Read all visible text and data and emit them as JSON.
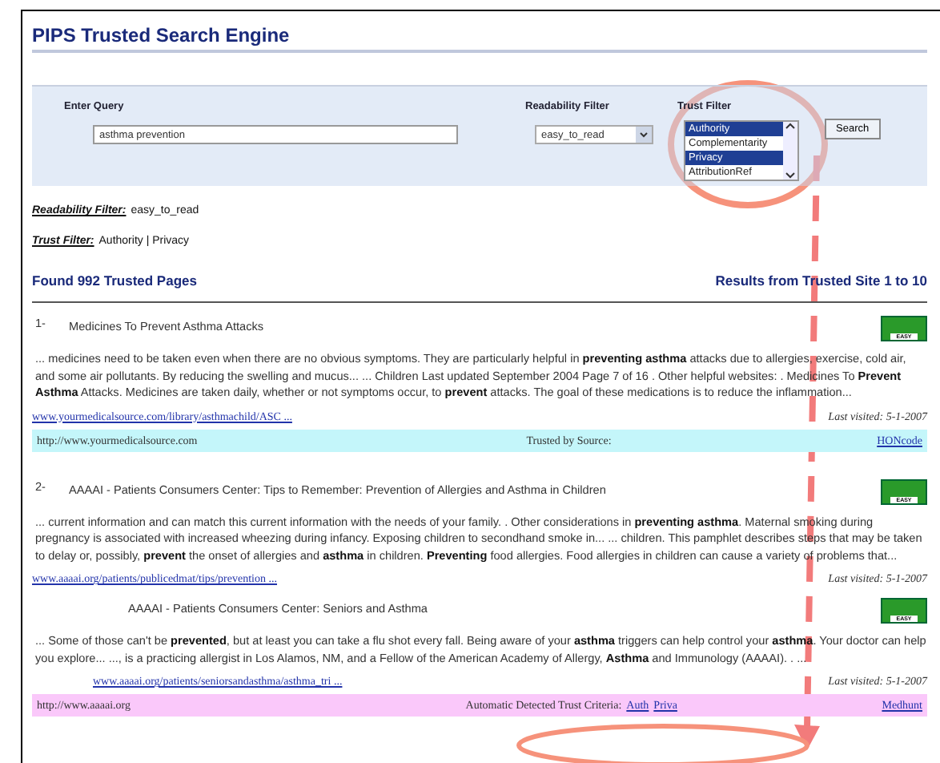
{
  "title": "PIPS Trusted Search Engine",
  "query": {
    "label": "Enter Query",
    "value": "asthma prevention"
  },
  "readability": {
    "label": "Readability Filter",
    "value": "easy_to_read"
  },
  "trust": {
    "label": "Trust Filter",
    "options": [
      {
        "label": "Authority",
        "selected": true
      },
      {
        "label": "Complementarity",
        "selected": false
      },
      {
        "label": "Privacy",
        "selected": true
      },
      {
        "label": "AttributionRef",
        "selected": false
      }
    ]
  },
  "search_button": "Search",
  "applied_filters": [
    {
      "label": "Readability Filter:",
      "value": "easy_to_read"
    },
    {
      "label": "Trust Filter:",
      "value": "Authority | Privacy"
    }
  ],
  "found": "Found 992 Trusted Pages",
  "range": "Results from Trusted Site 1 to 10",
  "groups": [
    {
      "results": [
        {
          "kind": "main",
          "number": "1-",
          "title": "Medicines To Prevent Asthma Attacks",
          "badge": "EASY",
          "snippet": "... medicines need to be taken even when there are no obvious symptoms. They are particularly helpful in **preventing asthma** attacks due to allergies, exercise, cold air, and some air pollutants. By reducing the swelling and mucus... ... Children Last updated September 2004 Page 7 of 16 . Other helpful websites: . Medicines To **Prevent Asthma** Attacks. Medicines are taken daily, whether or not symptoms occur, to **prevent** attacks. The goal of these medications is to reduce the inflammation...",
          "url": "www.yourmedicalsource.com/library/asthmachild/ASC ...",
          "last_visited": "Last visited: 5-1-2007"
        }
      ],
      "bar": {
        "color": "#c4f6fa",
        "site": "http://www.yourmedicalsource.com",
        "label": "Trusted by Source:",
        "source": "HONcode"
      }
    },
    {
      "results": [
        {
          "kind": "main",
          "number": "2-",
          "title": "AAAAI - Patients Consumers Center: Tips to Remember: Prevention of Allergies and Asthma in Children",
          "badge": "EASY",
          "snippet": "... current information and can match this current information with the needs of your family. . Other considerations in **preventing asthma**. Maternal smoking during pregnancy is associated with increased wheezing during infancy. Exposing children to secondhand smoke in... ... children. This pamphlet describes steps that may be taken to delay or, possibly, **prevent** the onset of allergies and **asthma** in children. **Preventing** food allergies. Food allergies in children can cause a variety of problems that...",
          "url": "www.aaaai.org/patients/publicedmat/tips/prevention ...",
          "last_visited": "Last visited: 5-1-2007"
        },
        {
          "kind": "sub",
          "title": "AAAAI - Patients Consumers Center: Seniors and Asthma",
          "badge": "EASY",
          "snippet": "... Some of those can't be **prevented**, but at least you can take a flu shot every fall. Being aware of your **asthma** triggers can help control your **asthma**. Your doctor can help you explore... ..., is a practicing allergist in Los Alamos, NM, and a Fellow of the American Academy of Allergy, **Asthma** and Immunology (AAAAI). . ...",
          "url": "www.aaaai.org/patients/seniorsandasthma/asthma_tri ...",
          "last_visited": "Last visited: 5-1-2007"
        }
      ],
      "bar": {
        "color": "#fac8fa",
        "site": "http://www.aaaai.org",
        "label": "Automatic Detected Trust Criteria:",
        "links": [
          "Auth",
          "Priva"
        ],
        "source": "Medhunt"
      }
    }
  ]
}
